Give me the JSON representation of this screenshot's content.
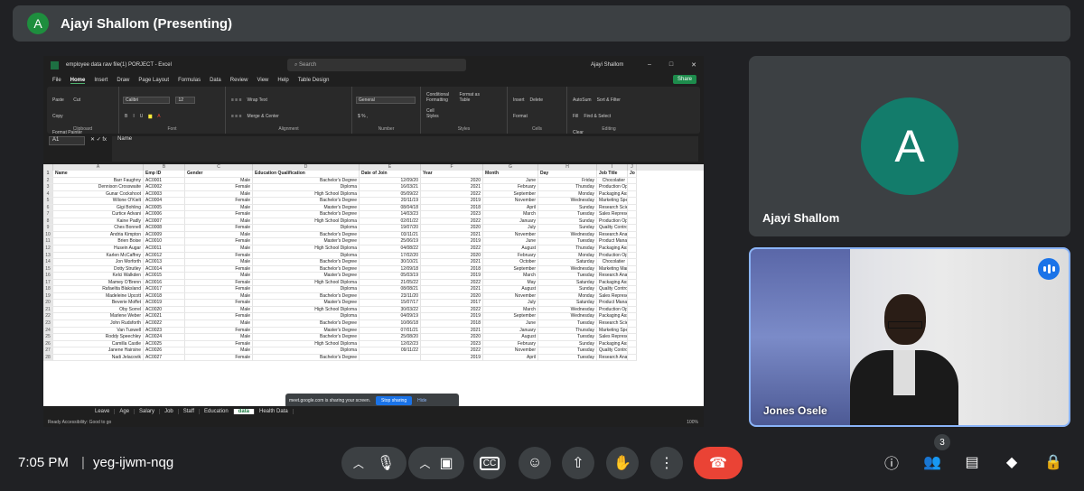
{
  "top": {
    "avatar": "A",
    "title": "Ajayi Shallom (Presenting)"
  },
  "excel": {
    "title": "employee data raw file(1) PORJECT - Excel",
    "search": "Search",
    "user": "Ajayi Shallom",
    "share": "Share",
    "menu": [
      "File",
      "Home",
      "Insert",
      "Draw",
      "Page Layout",
      "Formulas",
      "Data",
      "Review",
      "View",
      "Help",
      "Table Design"
    ],
    "clipboard": {
      "paste": "Paste",
      "cut": "Cut",
      "copy": "Copy",
      "painter": "Format Painter",
      "label": "Clipboard"
    },
    "font": {
      "name": "Calibri",
      "size": "12",
      "label": "Font"
    },
    "alignment": {
      "wrap": "Wrap Text",
      "merge": "Merge & Center",
      "label": "Alignment"
    },
    "number": {
      "format": "General",
      "label": "Number"
    },
    "styles": {
      "cond": "Conditional Formatting",
      "table": "Format as Table",
      "cell": "Cell Styles",
      "label": "Styles"
    },
    "cells": {
      "insert": "Insert",
      "delete": "Delete",
      "format": "Format",
      "label": "Cells"
    },
    "editing": {
      "autosum": "AutoSum",
      "fill": "Fill",
      "clear": "Clear",
      "sort": "Sort & Filter",
      "find": "Find & Select",
      "label": "Editing"
    },
    "namebox": "A1",
    "formula": "Name",
    "cols": [
      "A",
      "B",
      "C",
      "D",
      "E",
      "F",
      "G",
      "H",
      "I",
      "J"
    ],
    "headers": [
      "Name",
      "Emp ID",
      "Gender",
      "Education Qualification",
      "Date of Join",
      "Year",
      "Month",
      "Day",
      "Job Title",
      "Jo"
    ],
    "rows": [
      [
        "Barr Faughny",
        "AC0001",
        "Male",
        "Bachelor's Degree",
        "12/09/20",
        "2020",
        "June",
        "Friday",
        "Chocolatier"
      ],
      [
        "Dennison Crosswaite",
        "AC0002",
        "Female",
        "Diploma",
        "16/03/21",
        "2021",
        "February",
        "Thursday",
        "Production Operator"
      ],
      [
        "Gunar Cockshoot",
        "AC0003",
        "Male",
        "High School Diploma",
        "05/09/22",
        "2022",
        "September",
        "Monday",
        "Packaging Associate"
      ],
      [
        "Wilone O'Kielt",
        "AC0004",
        "Female",
        "Bachelor's Degree",
        "20/11/19",
        "2019",
        "November",
        "Wednesday",
        "Marketing Specialist"
      ],
      [
        "Gigi Bohling",
        "AC0005",
        "Male",
        "Master's Degree",
        "08/04/18",
        "2018",
        "April",
        "Sunday",
        "Research Scientist"
      ],
      [
        "Curtice Advani",
        "AC0006",
        "Female",
        "Bachelor's Degree",
        "14/03/23",
        "2023",
        "March",
        "Tuesday",
        "Sales Representative"
      ],
      [
        "Kaine Padly",
        "AC0007",
        "Male",
        "High School Diploma",
        "02/01/22",
        "2022",
        "January",
        "Sunday",
        "Production Operator"
      ],
      [
        "Ches Bonnell",
        "AC0008",
        "Female",
        "Diploma",
        "19/07/20",
        "2020",
        "July",
        "Sunday",
        "Quality Control"
      ],
      [
        "Andria Kimpton",
        "AC0009",
        "Male",
        "Bachelor's Degree",
        "03/11/21",
        "2021",
        "November",
        "Wednesday",
        "Research Analyst"
      ],
      [
        "Brien Boise",
        "AC0010",
        "Female",
        "Master's Degree",
        "25/06/19",
        "2019",
        "June",
        "Tuesday",
        "Product Manager"
      ],
      [
        "Husein Augar",
        "AC0011",
        "Male",
        "High School Diploma",
        "04/08/22",
        "2022",
        "August",
        "Thursday",
        "Packaging Associate"
      ],
      [
        "Karlen McCaffrey",
        "AC0012",
        "Female",
        "Diploma",
        "17/02/20",
        "2020",
        "February",
        "Monday",
        "Production Operator"
      ],
      [
        "Jon Morforth",
        "AC0013",
        "Male",
        "Bachelor's Degree",
        "30/10/21",
        "2021",
        "October",
        "Saturday",
        "Chocolatier"
      ],
      [
        "Dotty Strutley",
        "AC0014",
        "Female",
        "Bachelor's Degree",
        "12/09/18",
        "2018",
        "September",
        "Wednesday",
        "Marketing Manager"
      ],
      [
        "Kelci Walkden",
        "AC0015",
        "Male",
        "Master's Degree",
        "05/03/19",
        "2019",
        "March",
        "Tuesday",
        "Research Analyst"
      ],
      [
        "Mamey O'Brenn",
        "AC0016",
        "Female",
        "High School Diploma",
        "21/05/22",
        "2022",
        "May",
        "Saturday",
        "Packaging Associate"
      ],
      [
        "Rafaelita Blaksland",
        "AC0017",
        "Female",
        "Diploma",
        "08/08/21",
        "2021",
        "August",
        "Sunday",
        "Quality Control"
      ],
      [
        "Madeleine Upcott",
        "AC0018",
        "Male",
        "Bachelor's Degree",
        "23/11/20",
        "2020",
        "November",
        "Monday",
        "Sales Representative"
      ],
      [
        "Beverie Moffet",
        "AC0019",
        "Female",
        "Master's Degree",
        "15/07/17",
        "2017",
        "July",
        "Saturday",
        "Product Manager"
      ],
      [
        "Oby Sorrel",
        "AC0020",
        "Male",
        "High School Diploma",
        "30/03/22",
        "2022",
        "March",
        "Wednesday",
        "Production Operator"
      ],
      [
        "Marlene Weber",
        "AC0021",
        "Female",
        "Diploma",
        "04/09/19",
        "2019",
        "September",
        "Wednesday",
        "Packaging Associate"
      ],
      [
        "John Rudsforth",
        "AC0022",
        "Male",
        "Bachelor's Degree",
        "10/06/18",
        "2018",
        "June",
        "Tuesday",
        "Research Scientist"
      ],
      [
        "Van Tuxwell",
        "AC0023",
        "Female",
        "Master's Degree",
        "07/01/21",
        "2021",
        "January",
        "Thursday",
        "Marketing Specialist"
      ],
      [
        "Roddy Speechley",
        "AC0024",
        "Male",
        "Bachelor's Degree",
        "25/08/20",
        "2020",
        "August",
        "Tuesday",
        "Sales Representative"
      ],
      [
        "Camilla Castle",
        "AC0025",
        "Female",
        "High School Diploma",
        "12/02/23",
        "2023",
        "February",
        "Sunday",
        "Packaging Associate"
      ],
      [
        "Janene Hairsine",
        "AC0026",
        "Male",
        "Diploma",
        "09/11/22",
        "2022",
        "November",
        "Tuesday",
        "Quality Control"
      ],
      [
        "Nadi Jelacovik",
        "AC0027",
        "Female",
        "Bachelor's Degree",
        "",
        "2019",
        "April",
        "Tuesday",
        "Research Analyst"
      ]
    ],
    "tabs": [
      "Leave",
      "Age",
      "Salary",
      "Job",
      "Staff",
      "Education",
      "data",
      "Health Data"
    ],
    "active_tab": "data",
    "status": "Ready   Accessibility: Good to go",
    "zoom": "100%",
    "toast": {
      "text": "meet.google.com is sharing your screen.",
      "stop": "Stop sharing",
      "hide": "Hide"
    }
  },
  "tile1": {
    "avatar": "A",
    "name": "Ajayi Shallom"
  },
  "tile2": {
    "name": "Jones Osele"
  },
  "bottom": {
    "time": "7:05 PM",
    "sep": "|",
    "code": "yeg-ijwm-nqg",
    "people_count": "3"
  },
  "colors": {
    "meet_bg": "#202124",
    "end_call": "#ea4335",
    "avatar_teal": "#137c6b",
    "excel_green": "#1d6f42"
  }
}
